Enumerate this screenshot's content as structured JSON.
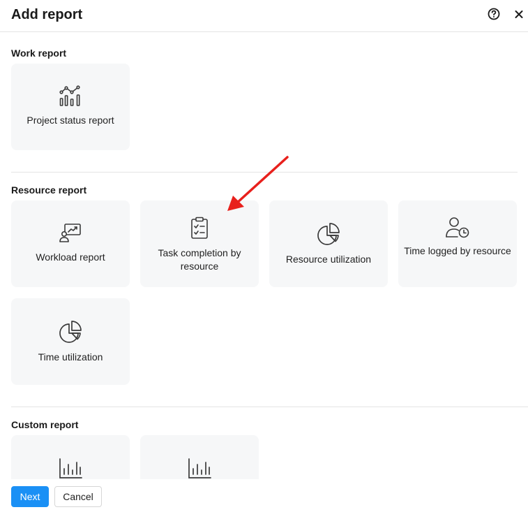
{
  "dialog": {
    "title": "Add report",
    "help_icon": "help-circle-icon",
    "close_icon": "close-icon"
  },
  "sections": {
    "work": {
      "label": "Work report",
      "cards": [
        {
          "label": "Project status report",
          "icon": "project-status-chart-icon"
        }
      ]
    },
    "resource": {
      "label": "Resource report",
      "cards": [
        {
          "label": "Workload report",
          "icon": "workload-presentation-icon"
        },
        {
          "label": "Task completion by resource",
          "icon": "clipboard-checklist-icon"
        },
        {
          "label": "Resource utilization",
          "icon": "pie-chart-icon"
        },
        {
          "label": "Time logged by resource",
          "icon": "user-clock-icon"
        },
        {
          "label": "Time utilization",
          "icon": "pie-chart-icon"
        }
      ]
    },
    "custom": {
      "label": "Custom report",
      "cards": [
        {
          "icon": "bar-chart-icon"
        },
        {
          "icon": "bar-chart-icon"
        }
      ]
    }
  },
  "footer": {
    "next_label": "Next",
    "cancel_label": "Cancel"
  },
  "colors": {
    "primary": "#1a90f5",
    "card_bg": "#f6f7f8",
    "annotation_arrow": "#e8201c"
  }
}
